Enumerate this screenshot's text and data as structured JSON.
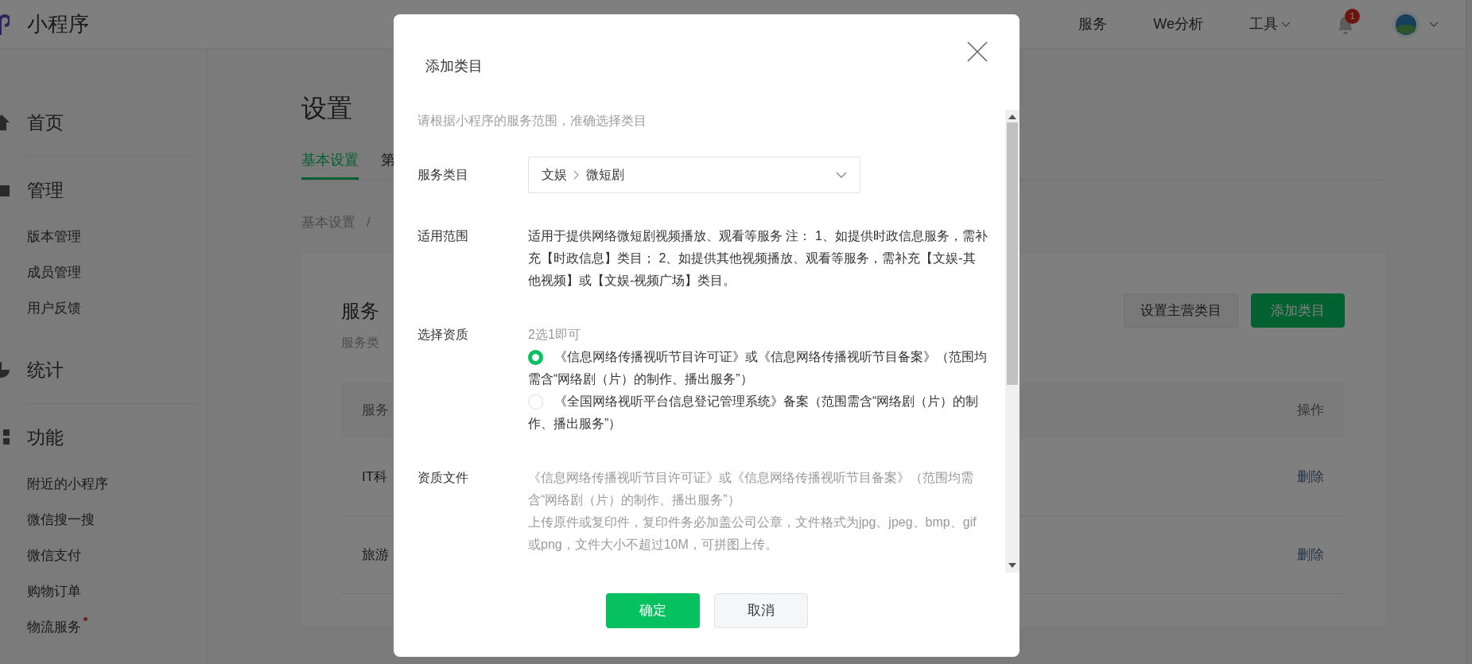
{
  "top_bar": {
    "logo": "小程序",
    "nav": [
      {
        "label": "服务",
        "dropdown": false
      },
      {
        "label": "We分析",
        "dropdown": false
      },
      {
        "label": "工具",
        "dropdown": true
      }
    ],
    "notification_count": "1"
  },
  "sidebar": {
    "sections": [
      {
        "title": "首页"
      },
      {
        "title": "管理",
        "items": [
          {
            "label": "版本管理",
            "dot": false
          },
          {
            "label": "成员管理",
            "dot": false
          },
          {
            "label": "用户反馈",
            "dot": false
          }
        ]
      },
      {
        "title": "统计"
      },
      {
        "title": "功能",
        "items": [
          {
            "label": "附近的小程序",
            "dot": false
          },
          {
            "label": "微信搜一搜",
            "dot": false
          },
          {
            "label": "微信支付",
            "dot": false
          },
          {
            "label": "购物订单",
            "dot": false
          },
          {
            "label": "物流服务",
            "dot": true
          }
        ]
      }
    ]
  },
  "page": {
    "title": "设置",
    "tabs": [
      {
        "label": "基本设置",
        "selected": true
      },
      {
        "label": "第",
        "selected": false
      }
    ],
    "breadcrumb": {
      "items": [
        "基本设置"
      ],
      "separator": "/"
    },
    "card": {
      "title": "服务",
      "subtitle": "服务类",
      "buttons": [
        {
          "label": "设置主营类目",
          "kind": "secondary"
        },
        {
          "label": "添加类目",
          "kind": "primary"
        }
      ],
      "table": {
        "columns": [
          "服务",
          "操作"
        ],
        "rows": [
          {
            "category": "IT科",
            "action": "删除"
          },
          {
            "category": "旅游",
            "action": "删除"
          }
        ]
      }
    }
  },
  "modal": {
    "title": "添加类目",
    "hint": "请根据小程序的服务范围，准确选择类目",
    "fields": [
      {
        "kind": "select",
        "label": "服务类目",
        "path": [
          "文娱",
          "微短剧"
        ]
      },
      {
        "kind": "text",
        "label": "适用范围",
        "paragraphs": [
          "适用于提供网络微短剧视频播放、观看等服务 注： 1、如提供时政信息服务，需补充【时政信息】类目； 2、如提供其他视频播放、观看等服务，需补充【文娱-其他视频】或【文娱-视频广场】类目。"
        ]
      },
      {
        "kind": "radio",
        "label": "选择资质",
        "note": "2选1即可",
        "options": [
          {
            "label": "《信息网络传播视听节目许可证》或《信息网络传播视听节目备案》（范围均需含“网络剧（片）的制作、播出服务”）",
            "selected": true
          },
          {
            "label": "《全国网络视听平台信息登记管理系统》备案（范围需含“网络剧（片）的制作、播出服务”）",
            "selected": false
          }
        ]
      },
      {
        "kind": "text",
        "label": "资质文件",
        "paragraphs": [
          "《信息网络传播视听节目许可证》或《信息网络传播视听节目备案》（范围均需含“网络剧（片）的制作、播出服务”）",
          "上传原件或复印件，复印件务必加盖公司公章，文件格式为jpg、jpeg、bmp、gif或png，文件大小不超过10M，可拼图上传。"
        ]
      }
    ],
    "buttons": [
      {
        "label": "确定",
        "kind": "primary"
      },
      {
        "label": "取消",
        "kind": "secondary"
      }
    ]
  }
}
